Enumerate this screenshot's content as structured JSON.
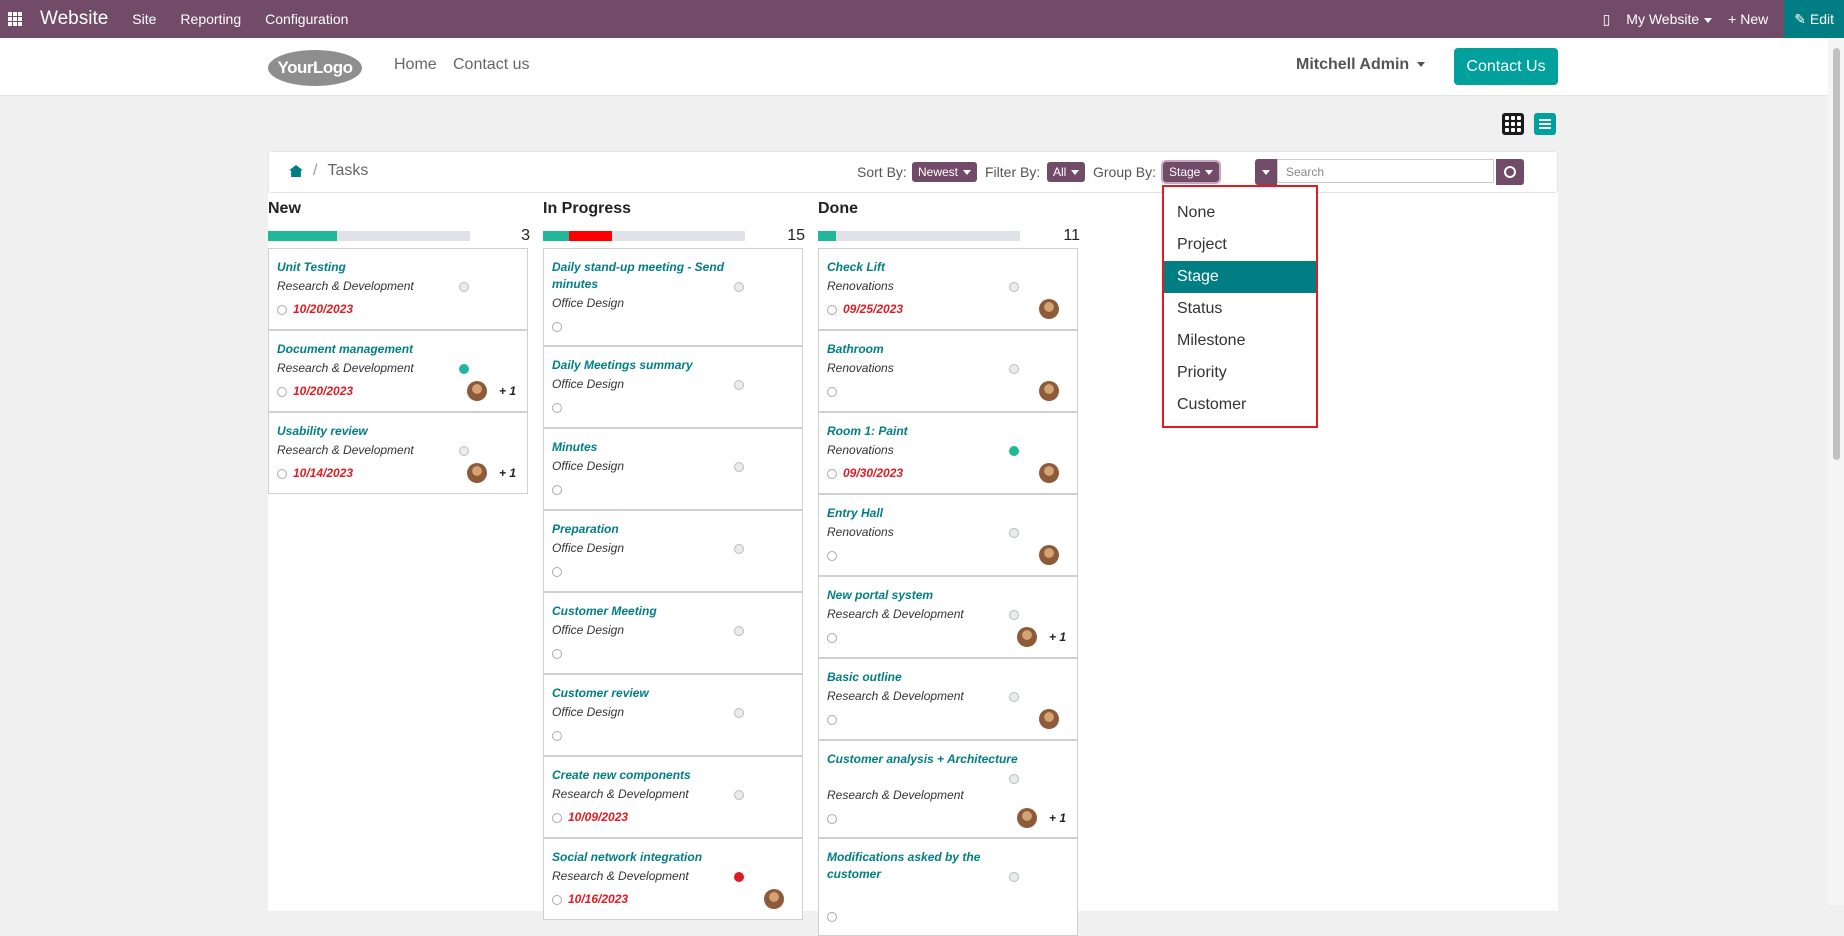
{
  "topbar": {
    "brand": "Website",
    "menus": [
      "Site",
      "Reporting",
      "Configuration"
    ],
    "my_website": "My Website",
    "new_label": "+ New",
    "edit_label": "✎ Edit"
  },
  "header": {
    "logo_text": "YourLogo",
    "nav": [
      "Home",
      "Contact us"
    ],
    "user": "Mitchell Admin",
    "contact_button": "Contact Us"
  },
  "breadcrumb": {
    "sep": "/",
    "current": "Tasks"
  },
  "controls": {
    "sort_label": "Sort By:",
    "sort_value": "Newest",
    "filter_label": "Filter By:",
    "filter_value": "All",
    "group_label": "Group By:",
    "group_value": "Stage",
    "search_placeholder": "Search"
  },
  "group_options": [
    "None",
    "Project",
    "Stage",
    "Status",
    "Milestone",
    "Priority",
    "Customer"
  ],
  "columns": [
    {
      "title": "New",
      "count": "3",
      "progress_green": 0.34,
      "progress_red": 0,
      "cards": [
        {
          "name": "Unit Testing",
          "project": "Research & Development",
          "date": "10/20/2023",
          "status": "grey",
          "avatar": false,
          "plus": ""
        },
        {
          "name": "Document management",
          "project": "Research & Development",
          "date": "10/20/2023",
          "status": "green",
          "avatar": true,
          "plus": "+ 1"
        },
        {
          "name": "Usability review",
          "project": "Research & Development",
          "date": "10/14/2023",
          "status": "grey",
          "avatar": true,
          "plus": "+ 1"
        }
      ]
    },
    {
      "title": "In Progress",
      "count": "15",
      "progress_green": 0.13,
      "progress_red": 0.21,
      "cards": [
        {
          "name": "Daily stand-up meeting - Send minutes",
          "project": "Office Design",
          "date": "",
          "status": "grey",
          "avatar": false,
          "plus": ""
        },
        {
          "name": "Daily Meetings summary",
          "project": "Office Design",
          "date": "",
          "status": "grey",
          "avatar": false,
          "plus": ""
        },
        {
          "name": "Minutes",
          "project": "Office Design",
          "date": "",
          "status": "grey",
          "avatar": false,
          "plus": ""
        },
        {
          "name": "Preparation",
          "project": "Office Design",
          "date": "",
          "status": "grey",
          "avatar": false,
          "plus": ""
        },
        {
          "name": "Customer Meeting",
          "project": "Office Design",
          "date": "",
          "status": "grey",
          "avatar": false,
          "plus": ""
        },
        {
          "name": "Customer review",
          "project": "Office Design",
          "date": "",
          "status": "grey",
          "avatar": false,
          "plus": ""
        },
        {
          "name": "Create new components",
          "project": "Research & Development",
          "date": "10/09/2023",
          "status": "grey",
          "avatar": false,
          "plus": ""
        },
        {
          "name": "Social network integration",
          "project": "Research & Development",
          "date": "10/16/2023",
          "status": "red",
          "avatar": true,
          "plus": ""
        }
      ]
    },
    {
      "title": "Done",
      "count": "11",
      "progress_green": 0.09,
      "progress_red": 0,
      "cards": [
        {
          "name": "Check Lift",
          "project": "Renovations",
          "date": "09/25/2023",
          "status": "grey",
          "avatar": true,
          "plus": ""
        },
        {
          "name": "Bathroom",
          "project": "Renovations",
          "date": "",
          "status": "grey",
          "avatar": true,
          "plus": ""
        },
        {
          "name": "Room 1: Paint",
          "project": "Renovations",
          "date": "09/30/2023",
          "status": "green",
          "avatar": true,
          "plus": ""
        },
        {
          "name": "Entry Hall",
          "project": "Renovations",
          "date": "",
          "status": "grey",
          "avatar": true,
          "plus": ""
        },
        {
          "name": "New portal system",
          "project": "Research & Development",
          "date": "",
          "status": "grey",
          "avatar": true,
          "plus": "+ 1"
        },
        {
          "name": "Basic outline",
          "project": "Research & Development",
          "date": "",
          "status": "grey",
          "avatar": true,
          "plus": ""
        },
        {
          "name": "Customer analysis + Architecture",
          "project": "Research & Development",
          "date": "",
          "status": "grey",
          "avatar": true,
          "plus": "+ 1"
        },
        {
          "name": "Modifications asked by the customer",
          "project": "",
          "date": "",
          "status": "grey",
          "avatar": false,
          "plus": ""
        }
      ]
    }
  ]
}
